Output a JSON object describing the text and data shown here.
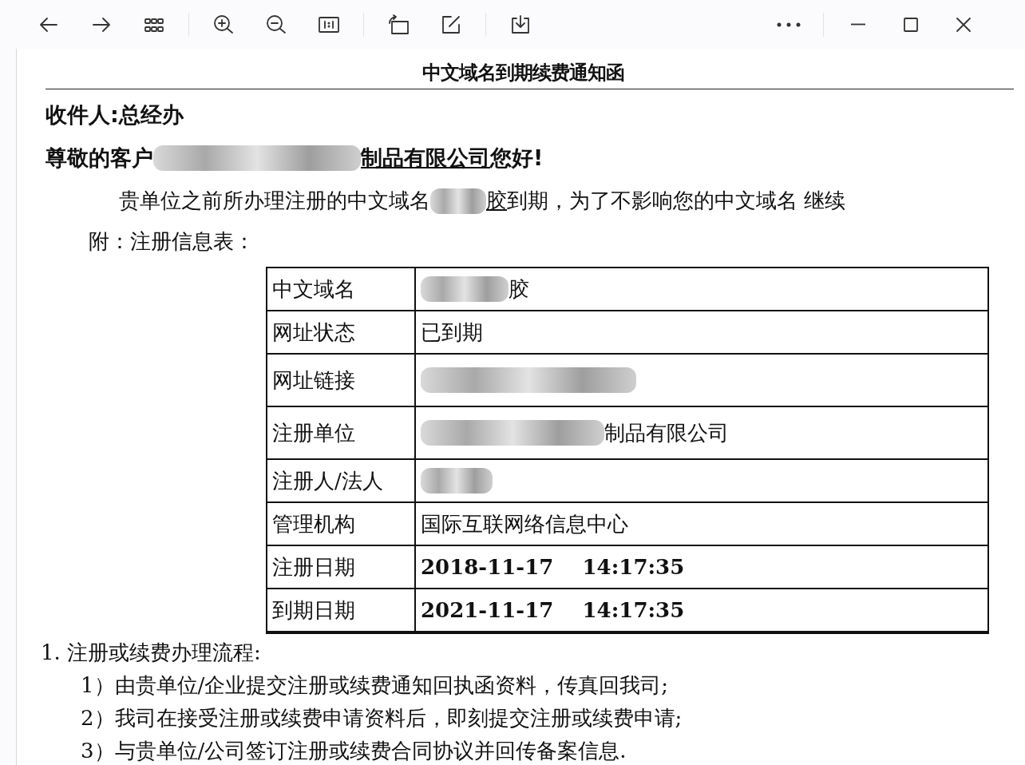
{
  "document": {
    "title": "中文域名到期续费通知函",
    "recipient": "收件人:总经办",
    "greeting": [
      {
        "kind": "text",
        "text": "尊敬的客户"
      },
      {
        "kind": "redacted"
      },
      {
        "kind": "link",
        "text": "制品有限公司"
      },
      {
        "kind": "text",
        "text": "您好!"
      }
    ],
    "intro": [
      {
        "kind": "text",
        "text": "贵单位之前所办理注册的中文域名"
      },
      {
        "kind": "redacted"
      },
      {
        "kind": "link",
        "text": "胶"
      },
      {
        "kind": "text",
        "text": "到期，为了不影响您的中文域名  继续"
      }
    ],
    "attachment_label": "附：注册信息表：",
    "table": [
      {
        "label": "中文域名",
        "value": [
          {
            "kind": "redacted"
          },
          {
            "kind": "text",
            "text": "胶"
          }
        ]
      },
      {
        "label": "网址状态",
        "value": [
          {
            "kind": "text",
            "text": "已到期"
          }
        ]
      },
      {
        "label": "网址链接",
        "value": [
          {
            "kind": "redacted"
          }
        ]
      },
      {
        "label": "注册单位",
        "value": [
          {
            "kind": "redacted"
          },
          {
            "kind": "text",
            "text": "制品有限公司"
          }
        ]
      },
      {
        "label": "注册人/法人",
        "value": [
          {
            "kind": "redacted"
          }
        ]
      },
      {
        "label": "管理机构",
        "value": [
          {
            "kind": "text",
            "text": "国际互联网络信息中心"
          }
        ]
      },
      {
        "label": "注册日期",
        "value": [
          {
            "kind": "date",
            "text": "2018-11-17    14:17:35"
          }
        ]
      },
      {
        "label": "到期日期",
        "value": [
          {
            "kind": "date",
            "text": "2021-11-17    14:17:35"
          }
        ]
      }
    ],
    "section_heading": "1. 注册或续费办理流程:",
    "steps": [
      "1）由贵单位/企业提交注册或续费通知回执函资料，传真回我司;",
      "2）我司在接受注册或续费申请资料后，即刻提交注册或续费申请;",
      "3）与贵单位/公司签订注册或续费合同协议并回传备案信息."
    ]
  }
}
